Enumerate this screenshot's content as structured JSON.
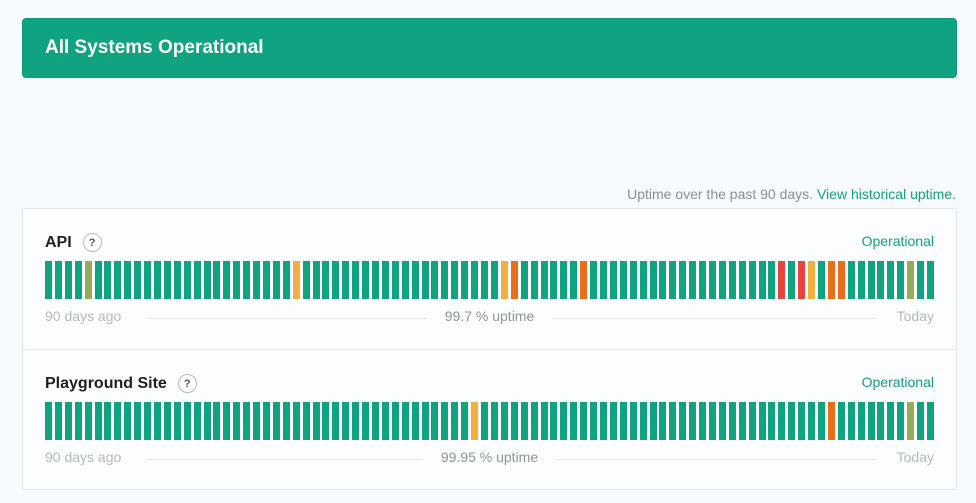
{
  "banner": {
    "title": "All Systems Operational"
  },
  "uptime_note": {
    "text": "Uptime over the past 90 days.",
    "link": "View historical uptime."
  },
  "colors": {
    "green": "#10a37f",
    "yellow": "#f0b03f",
    "orange": "#e86f1a",
    "red": "#e2463f",
    "olive": "#94ac58"
  },
  "components": [
    {
      "name": "API",
      "help": "?",
      "status": "Operational",
      "days_ago_label": "90 days ago",
      "uptime_label": "99.7 % uptime",
      "today_label": "Today",
      "days": [
        "g",
        "g",
        "g",
        "g",
        "olive",
        "g",
        "g",
        "g",
        "g",
        "g",
        "g",
        "g",
        "g",
        "g",
        "g",
        "g",
        "g",
        "g",
        "g",
        "g",
        "g",
        "g",
        "g",
        "g",
        "g",
        "yellow",
        "g",
        "g",
        "g",
        "g",
        "g",
        "g",
        "g",
        "g",
        "g",
        "g",
        "g",
        "g",
        "g",
        "g",
        "g",
        "g",
        "g",
        "g",
        "g",
        "g",
        "yellow",
        "orange",
        "g",
        "g",
        "g",
        "g",
        "g",
        "g",
        "orange",
        "g",
        "g",
        "g",
        "g",
        "g",
        "g",
        "g",
        "g",
        "g",
        "g",
        "g",
        "g",
        "g",
        "g",
        "g",
        "g",
        "g",
        "g",
        "g",
        "red",
        "g",
        "red",
        "yellow",
        "g",
        "orange",
        "orange",
        "g",
        "g",
        "g",
        "g",
        "g",
        "g",
        "olive",
        "g",
        "g"
      ]
    },
    {
      "name": "Playground Site",
      "help": "?",
      "status": "Operational",
      "days_ago_label": "90 days ago",
      "uptime_label": "99.95 % uptime",
      "today_label": "Today",
      "days": [
        "g",
        "g",
        "g",
        "g",
        "g",
        "g",
        "g",
        "g",
        "g",
        "g",
        "g",
        "g",
        "g",
        "g",
        "g",
        "g",
        "g",
        "g",
        "g",
        "g",
        "g",
        "g",
        "g",
        "g",
        "g",
        "g",
        "g",
        "g",
        "g",
        "g",
        "g",
        "g",
        "g",
        "g",
        "g",
        "g",
        "g",
        "g",
        "g",
        "g",
        "g",
        "g",
        "g",
        "yellow",
        "g",
        "g",
        "g",
        "g",
        "g",
        "g",
        "g",
        "g",
        "g",
        "g",
        "g",
        "g",
        "g",
        "g",
        "g",
        "g",
        "g",
        "g",
        "g",
        "g",
        "g",
        "g",
        "g",
        "g",
        "g",
        "g",
        "g",
        "g",
        "g",
        "g",
        "g",
        "g",
        "g",
        "g",
        "g",
        "orange",
        "g",
        "g",
        "g",
        "g",
        "g",
        "g",
        "g",
        "olive",
        "g",
        "g"
      ]
    }
  ]
}
